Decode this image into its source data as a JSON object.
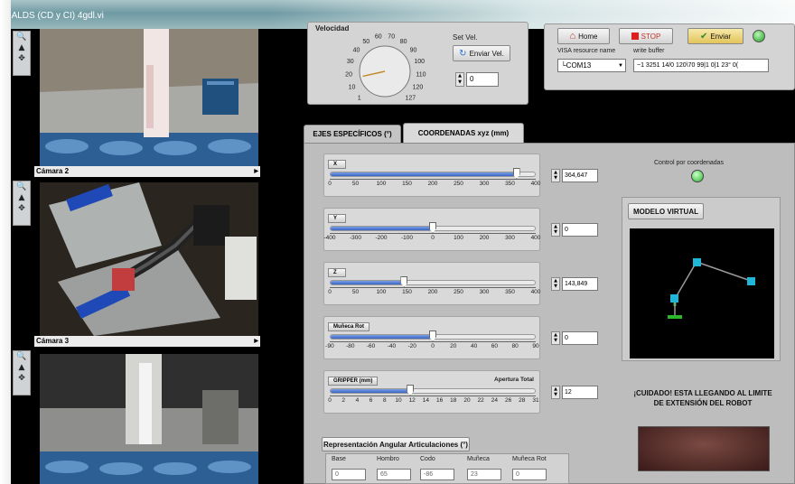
{
  "window": {
    "title": "ot ALDS (CD y CI) 4gdl.vi"
  },
  "cameras": [
    {
      "label": "Cámara 2"
    },
    {
      "label": "Cámara 3"
    }
  ],
  "velocity": {
    "title": "Velocidad",
    "dial_labels": [
      "1",
      "10",
      "20",
      "30",
      "40",
      "50",
      "60",
      "70",
      "80",
      "90",
      "100",
      "110",
      "120",
      "127"
    ],
    "set_label": "Set Vel.",
    "send_label": "Enviar Vel.",
    "value": "0"
  },
  "comm": {
    "home_label": "Home",
    "stop_label": "STOP",
    "send_label": "Enviar",
    "visa_label": "VISA resource name",
    "buffer_label": "write buffer",
    "visa_value": "COM13",
    "buffer_value": "~1 3251 14/0 120\\70 99|1 0|1 23° 0("
  },
  "tabs": [
    {
      "label": "EJES ESPECÍFICOS (°)",
      "active": false
    },
    {
      "label": "COORDENADAS xyz (mm)",
      "active": true
    }
  ],
  "sliders": [
    {
      "label": "X",
      "value": "364,647",
      "fraction": 0.91,
      "ticks": [
        "0",
        "50",
        "100",
        "150",
        "200",
        "250",
        "300",
        "350",
        "400"
      ]
    },
    {
      "label": "Y",
      "value": "0",
      "fraction": 0.5,
      "ticks": [
        "-400",
        "-300",
        "-200",
        "-100",
        "0",
        "100",
        "200",
        "300",
        "400"
      ]
    },
    {
      "label": "Z",
      "value": "143,849",
      "fraction": 0.36,
      "ticks": [
        "0",
        "50",
        "100",
        "150",
        "200",
        "250",
        "300",
        "350",
        "400"
      ]
    },
    {
      "label": "Muñeca Rot",
      "value": "0",
      "fraction": 0.5,
      "ticks": [
        "-90",
        "-80",
        "-60",
        "-40",
        "-20",
        "0",
        "20",
        "40",
        "60",
        "80",
        "90"
      ]
    },
    {
      "label": "GRIPPER (mm)",
      "value": "12",
      "fraction": 0.39,
      "extra": "Apertura Total",
      "ticks": [
        "0",
        "2",
        "4",
        "6",
        "8",
        "10",
        "12",
        "14",
        "16",
        "18",
        "20",
        "22",
        "24",
        "26",
        "28",
        "31"
      ]
    }
  ],
  "control": {
    "label": "Control por coordenadas",
    "led_color": "#3fd13f"
  },
  "model": {
    "button": "MODELO VIRTUAL"
  },
  "warning": {
    "text": "¡CUIDADO! ESTA LLEGANDO AL LIMITE DE EXTENSIÓN DEL ROBOT"
  },
  "joints": {
    "title": "Representación Angular Articulaciones (°)",
    "items": [
      {
        "label": "Base",
        "value": "0"
      },
      {
        "label": "Hombro",
        "value": "65"
      },
      {
        "label": "Codo",
        "value": "-86"
      },
      {
        "label": "Muñeca",
        "value": "23"
      },
      {
        "label": "Muñeca Rot",
        "value": "0"
      }
    ]
  }
}
